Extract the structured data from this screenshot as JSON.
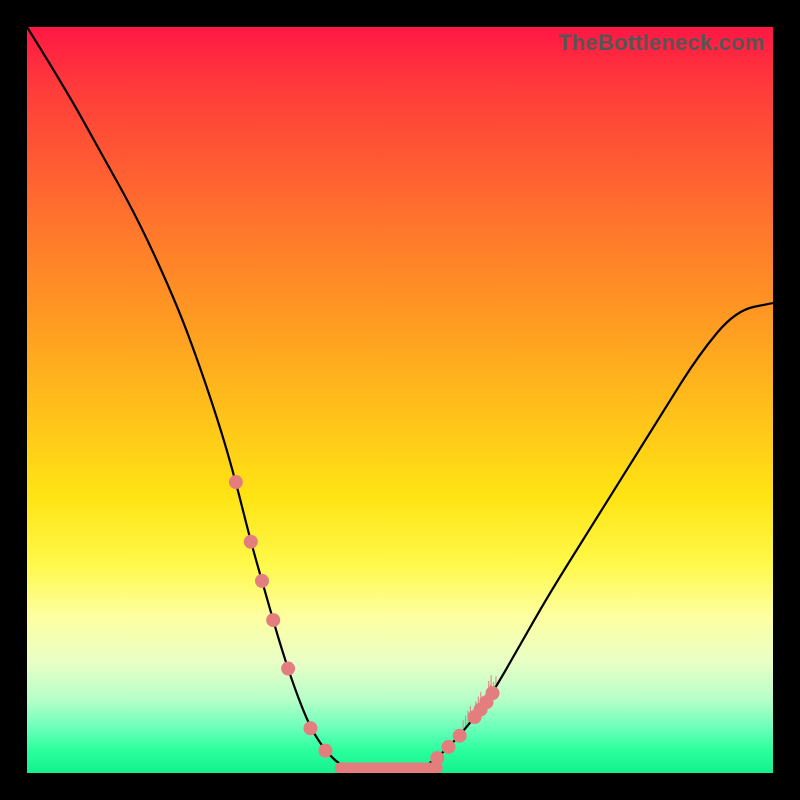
{
  "watermark": "TheBottleneck.com",
  "colors": {
    "frame": "#000000",
    "curve": "#000000",
    "marker": "#e47d7d"
  },
  "chart_data": {
    "type": "line",
    "title": "",
    "xlabel": "",
    "ylabel": "",
    "xlim": [
      0,
      100
    ],
    "ylim": [
      0,
      100
    ],
    "grid": false,
    "series": [
      {
        "name": "bottleneck-curve",
        "x": [
          0,
          5,
          10,
          15,
          20,
          23,
          26,
          28,
          30,
          32,
          34,
          36,
          38,
          40,
          42,
          45,
          48,
          52,
          55,
          58,
          62,
          66,
          70,
          75,
          80,
          85,
          90,
          95,
          100
        ],
        "y": [
          100,
          92,
          83,
          74,
          63,
          55,
          46,
          39,
          31,
          24,
          17,
          11,
          6,
          3,
          1,
          0,
          0,
          0,
          2,
          5,
          10,
          17,
          24,
          32,
          40,
          48,
          56,
          62,
          63
        ]
      }
    ],
    "flat_bottom": {
      "x_start": 42,
      "x_end": 55,
      "y": 0
    },
    "left_markers_x": [
      28,
      30,
      31.5,
      33,
      35,
      38,
      40
    ],
    "right_markers_x": [
      55,
      56.5,
      58,
      60,
      60.8,
      61.6,
      62.4
    ],
    "fuzz_region": {
      "x_start": 59,
      "x_end": 63
    }
  }
}
